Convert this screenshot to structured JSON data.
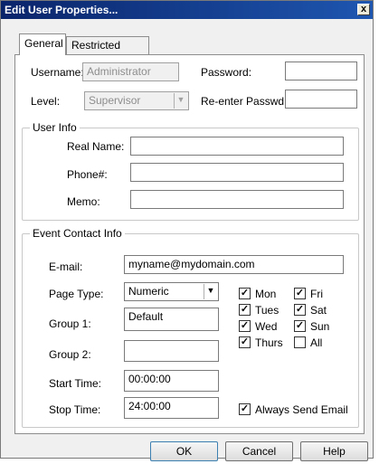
{
  "window": {
    "title": "Edit User Properties...",
    "close_glyph": "x"
  },
  "tabs": [
    {
      "label": "General"
    },
    {
      "label": "Restricted View"
    }
  ],
  "account": {
    "username_label": "Username:",
    "username_value": "Administrator",
    "level_label": "Level:",
    "level_value": "Supervisor",
    "password_label": "Password:",
    "password_value": "",
    "reenter_label": "Re-enter Passwd:",
    "reenter_value": ""
  },
  "user_info": {
    "title": "User Info",
    "real_name_label": "Real Name:",
    "real_name_value": "",
    "phone_label": "Phone#:",
    "phone_value": "",
    "memo_label": "Memo:",
    "memo_value": ""
  },
  "event_contact": {
    "title": "Event Contact Info",
    "email_label": "E-mail:",
    "email_value": "myname@mydomain.com",
    "page_type_label": "Page Type:",
    "page_type_value": "Numeric",
    "group1_label": "Group 1:",
    "group1_value": "Default",
    "group2_label": "Group 2:",
    "group2_value": "",
    "start_time_label": "Start Time:",
    "start_time_value": "00:00:00",
    "stop_time_label": "Stop Time:",
    "stop_time_value": "24:00:00",
    "days": {
      "mon": {
        "label": "Mon",
        "checked": true
      },
      "tues": {
        "label": "Tues",
        "checked": true
      },
      "wed": {
        "label": "Wed",
        "checked": true
      },
      "thurs": {
        "label": "Thurs",
        "checked": true
      },
      "fri": {
        "label": "Fri",
        "checked": true
      },
      "sat": {
        "label": "Sat",
        "checked": true
      },
      "sun": {
        "label": "Sun",
        "checked": true
      },
      "all": {
        "label": "All",
        "checked": false
      }
    },
    "always_send_email": {
      "label": "Always Send Email",
      "checked": true
    }
  },
  "buttons": {
    "ok": "OK",
    "cancel": "Cancel",
    "help": "Help"
  },
  "check_glyph": "✓"
}
